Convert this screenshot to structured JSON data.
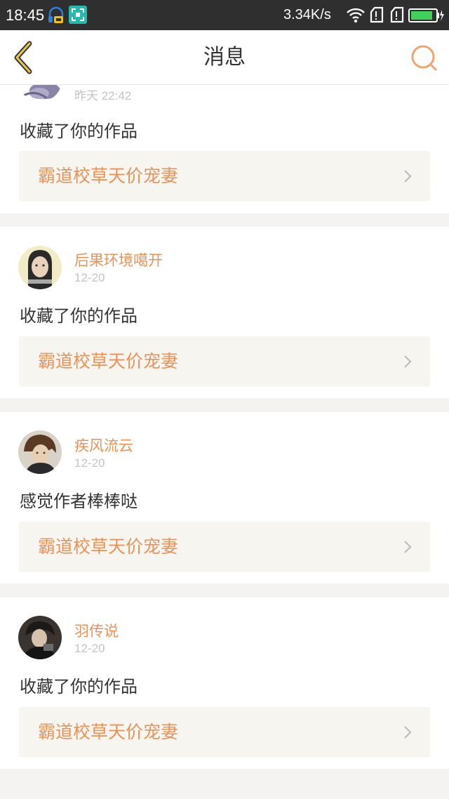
{
  "status_bar": {
    "time": "18:45",
    "net_speed": "3.34K/s",
    "icons": [
      "headset-app-icon",
      "screenshot-app-icon",
      "wifi-icon",
      "signal-icon",
      "signal-icon",
      "battery-icon"
    ]
  },
  "nav": {
    "title": "消息",
    "back_icon": "chevron-left-icon",
    "search_icon": "search-icon"
  },
  "colors": {
    "accent": "#e8935a",
    "back_arrow": "#e0b84a",
    "text": "#333333",
    "muted": "#c4c4c4",
    "card_bg": "#ffffff",
    "page_bg": "#f5f3f2",
    "work_bg": "#f6f5f0"
  },
  "messages": [
    {
      "username": "",
      "time": "昨天 22:42",
      "text": "收藏了你的作品",
      "work_title": "霸道校草天价宠妻"
    },
    {
      "username": "后果环境噶开",
      "time": "12-20",
      "text": "收藏了你的作品",
      "work_title": "霸道校草天价宠妻"
    },
    {
      "username": "疾风流云",
      "time": "12-20",
      "text": "感觉作者棒棒哒",
      "work_title": "霸道校草天价宠妻"
    },
    {
      "username": "羽传说",
      "time": "12-20",
      "text": "收藏了你的作品",
      "work_title": "霸道校草天价宠妻"
    }
  ]
}
